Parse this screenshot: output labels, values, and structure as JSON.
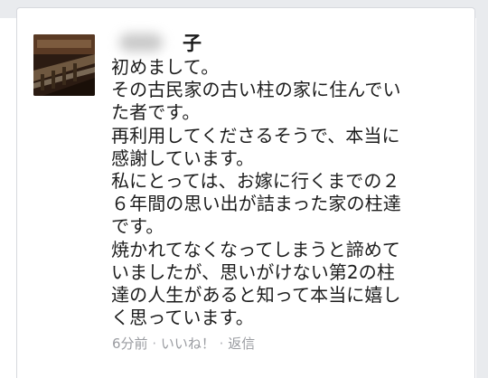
{
  "post": {
    "author_suffix": "子",
    "lines": [
      "初めまして。",
      "その古民家の古い柱の家に住んでい",
      "た者です。",
      "再利用してくださるそうで、本当に",
      "感謝しています。",
      "私にとっては、お嫁に行くまでの２",
      "６年間の思い出が詰まった家の柱達",
      "です。",
      "焼かれてなくなってしまうと諦めて",
      "いましたが、思いがけない第2の柱",
      "達の人生があると知って本当に嬉し",
      "く思っています。"
    ],
    "meta": {
      "time": "6分前",
      "separator": " · ",
      "like": "いいね！",
      "reply": "返信"
    }
  }
}
